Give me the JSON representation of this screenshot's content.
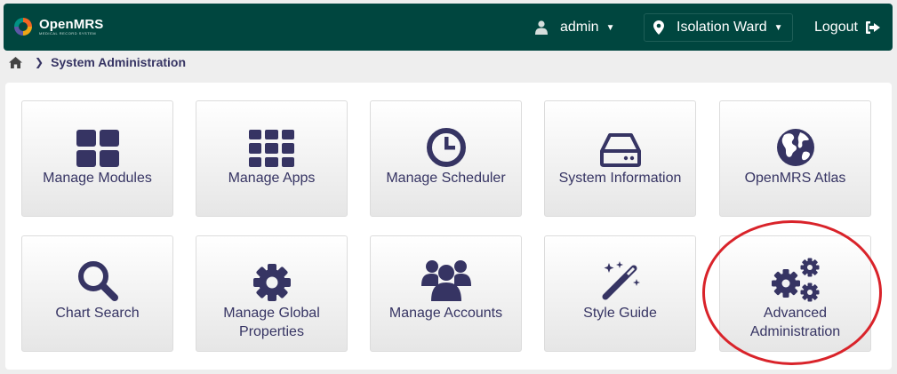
{
  "header": {
    "logo_name": "OpenMRS",
    "logo_tagline": "MEDICAL RECORD SYSTEM",
    "user": "admin",
    "location": "Isolation Ward",
    "logout": "Logout"
  },
  "breadcrumb": {
    "current": "System Administration"
  },
  "apps": [
    {
      "label": "Manage Modules",
      "icon": "th-large-icon"
    },
    {
      "label": "Manage Apps",
      "icon": "th-icon"
    },
    {
      "label": "Manage Scheduler",
      "icon": "clock-icon"
    },
    {
      "label": "System Information",
      "icon": "hdd-icon"
    },
    {
      "label": "OpenMRS Atlas",
      "icon": "globe-icon"
    },
    {
      "label": "Chart Search",
      "icon": "search-icon"
    },
    {
      "label": "Manage Global Properties",
      "icon": "cog-icon"
    },
    {
      "label": "Manage Accounts",
      "icon": "users-icon"
    },
    {
      "label": "Style Guide",
      "icon": "magic-wand-icon"
    },
    {
      "label": "Advanced Administration",
      "icon": "cogs-icon"
    }
  ],
  "colors": {
    "header_bg": "#00463f",
    "icon_color": "#363463",
    "highlight": "#d9232a"
  }
}
